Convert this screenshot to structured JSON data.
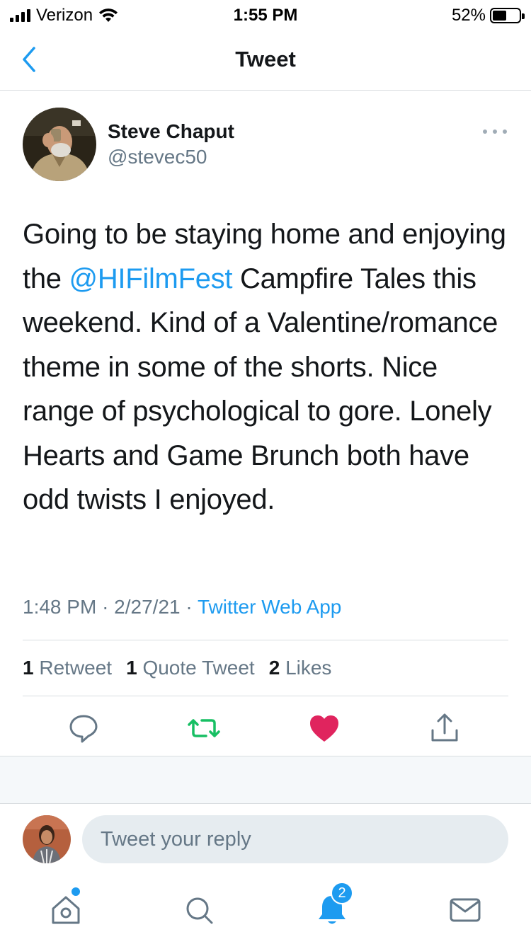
{
  "status_bar": {
    "carrier": "Verizon",
    "time": "1:55 PM",
    "battery_percent": "52%",
    "battery_level": 0.52
  },
  "nav": {
    "title": "Tweet",
    "back_icon": "chevron-left-icon"
  },
  "tweet": {
    "author": {
      "display_name": "Steve Chaput",
      "handle": "@stevec50"
    },
    "text_before": "Going to be staying home and enjoying the ",
    "mention": "@HIFilmFest",
    "text_after": " Campfire Tales this weekend. Kind of a Valentine/romance theme in some of the shorts. Nice range of psychological to gore. Lonely Hearts and Game Brunch both have odd twists I enjoyed.",
    "time": "1:48 PM",
    "separator": "·",
    "date": "2/27/21",
    "source": "Twitter Web App",
    "stats": {
      "retweets_count": "1",
      "retweets_label": "Retweet",
      "quotes_count": "1",
      "quotes_label": "Quote Tweet",
      "likes_count": "2",
      "likes_label": "Likes"
    },
    "liked": true
  },
  "reply": {
    "placeholder": "Tweet your reply"
  },
  "tabbar": {
    "notifications_badge": "2"
  },
  "colors": {
    "accent": "#1d9bf0",
    "retweet_green": "#17bf63",
    "like_red": "#e0245e",
    "secondary_text": "#657786"
  }
}
